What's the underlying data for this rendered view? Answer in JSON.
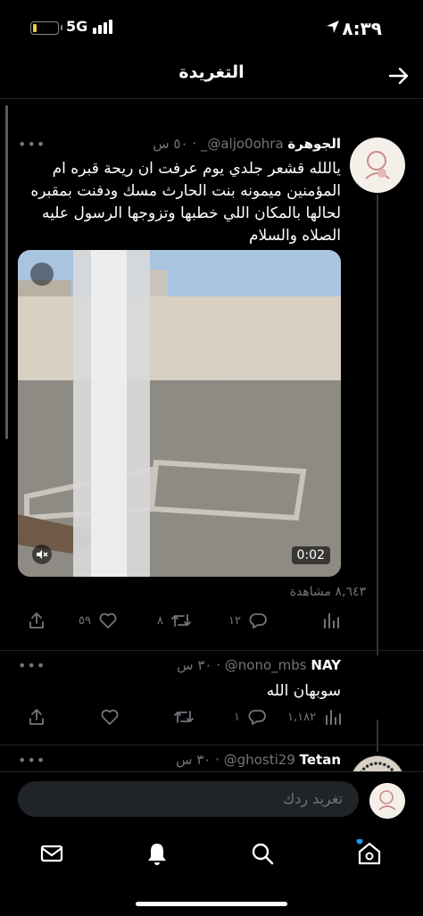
{
  "status_bar": {
    "time": "٨:٣٩",
    "network": "5G"
  },
  "nav": {
    "title": "التغريدة"
  },
  "tweets": [
    {
      "name": "الجوهرة",
      "handle": "_@aljo0ohra",
      "time": "٥٠ س",
      "text": "ياللله قشعر جلدي يوم عرفت ان ريحة قبره ام المؤمنين ميمونه بنت الحارث مسك ودفنت بمقبره لحالها بالمكان اللي خطبها وتزوجها الرسول عليه الصلاه والسلام",
      "video_duration": "0:02",
      "views": "٨,٦٤٣ مشاهدة",
      "reply_count": "١٢",
      "retweet_count": "٨",
      "like_count": "٥٩"
    },
    {
      "name": "NAY",
      "handle": "@nono_mbs",
      "time": "٣٠ س",
      "text": "سوبهان الله",
      "reply_count": "١",
      "views_count": "١,١٨٢"
    },
    {
      "name": "Tetan",
      "handle": "@ghosti29",
      "time": "٣٠ س"
    }
  ],
  "reply_bar": {
    "placeholder": "تغريد ردك"
  },
  "icons": {
    "back": "arrow-right-icon",
    "more": "more-dots-icon",
    "reply": "reply-icon",
    "retweet": "retweet-icon",
    "like": "heart-icon",
    "share": "share-icon",
    "views": "views-chart-icon",
    "mute": "mute-icon",
    "tabs": [
      "home-icon",
      "search-icon",
      "notifications-icon",
      "messages-icon"
    ]
  },
  "colors": {
    "background": "#000000",
    "muted": "#71767b",
    "accent": "#1d9bf0"
  }
}
